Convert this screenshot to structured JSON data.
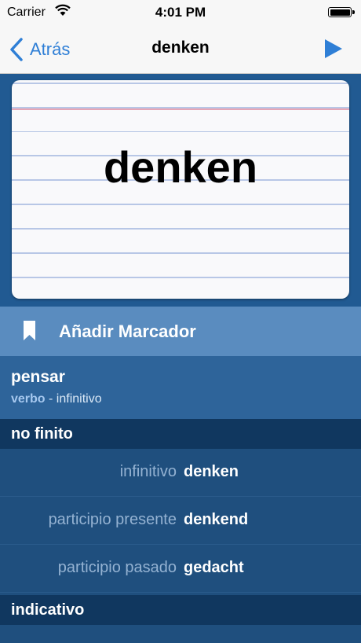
{
  "status_bar": {
    "carrier": "Carrier",
    "time": "4:01 PM"
  },
  "nav": {
    "back_label": "Atrás",
    "title": "denken",
    "accent_color": "#2f7fd6"
  },
  "card": {
    "word": "denken"
  },
  "bookmark": {
    "label": "Añadir Marcador"
  },
  "definition": {
    "translation": "pensar",
    "pos_type": "verbo",
    "pos_separator": " - ",
    "pos_detail": "infinitivo"
  },
  "sections": [
    {
      "title": "no finito",
      "rows": [
        {
          "key": "infinitivo",
          "value": "denken"
        },
        {
          "key": "participio presente",
          "value": "denkend"
        },
        {
          "key": "participio pasado",
          "value": "gedacht"
        }
      ]
    },
    {
      "title": "indicativo",
      "rows": []
    }
  ]
}
